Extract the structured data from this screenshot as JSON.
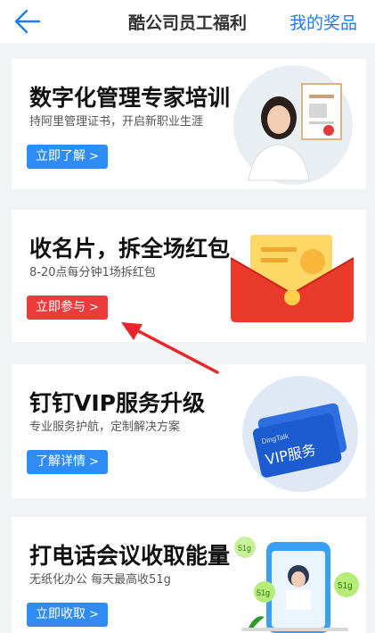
{
  "header": {
    "back_icon": "back-arrow-icon",
    "title": "酷公司员工福利",
    "right_link": "我的奖品"
  },
  "cards": [
    {
      "title": "数字化管理专家培训",
      "subtitle": "持阿里管理证书，开启新职业生涯",
      "button": "立即了解",
      "button_color": "#2f8cf5",
      "illustration": "woman-with-certificate"
    },
    {
      "title": "收名片，拆全场红包",
      "subtitle": "8-20点每分钟1场拆红包",
      "button": "立即参与",
      "button_color": "#ec3b3b",
      "illustration": "red-envelope"
    },
    {
      "title": "钉钉VIP服务升级",
      "subtitle": "专业服务护航，定制解决方案",
      "button": "了解详情",
      "button_color": "#2f8cf5",
      "illustration": "vip-card",
      "card_brand": "DingTalk",
      "card_text": "VIP服务"
    },
    {
      "title": "打电话会议收取能量",
      "subtitle": "无纸化办公 每天最高收51g",
      "button": "立即收取",
      "button_color": "#2f8cf5",
      "illustration": "phone-energy",
      "energy_label": "51g"
    }
  ],
  "annotation": {
    "arrow_color": "#e8262b"
  }
}
